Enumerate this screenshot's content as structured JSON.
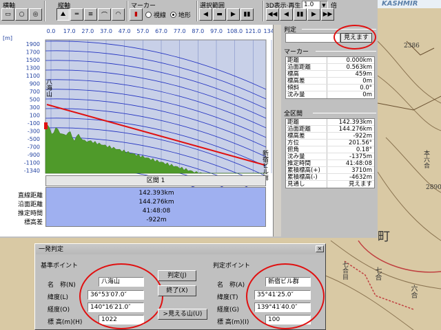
{
  "toolbar": {
    "scale_label": "横軸",
    "vscale_label": "縦軸",
    "marker_label": "マーカー",
    "radio_sightline": "視線",
    "radio_terrain": "地形",
    "selection_label": "選択範囲",
    "display3d_label": "3D表示",
    "playback_label": "再生",
    "speed_value": "1.0",
    "times_label": "倍"
  },
  "chart": {
    "unit_label": "[m]",
    "x_ticks": [
      "0.0",
      "17.0",
      "27.0",
      "37.0",
      "47.0",
      "57.0",
      "67.0",
      "77.0",
      "87.0",
      "97.0",
      "108.0",
      "121.0",
      "134.0"
    ],
    "y_ticks": [
      "1900",
      "1700",
      "1500",
      "1300",
      "1100",
      "900",
      "700",
      "500",
      "300",
      "100",
      "-100",
      "-300",
      "-500",
      "-700",
      "-900",
      "-1100",
      "-1340"
    ],
    "start_point": "八海山",
    "end_point": "新宿ビル群",
    "colors": {
      "terrain": "#4f9a2a",
      "sightline": "#e01010",
      "curves": "#2030c0"
    }
  },
  "section": {
    "header": "区間 1",
    "labels": [
      "直線距離",
      "沿面距離",
      "推定時間",
      "標高差"
    ],
    "values": [
      "142.393km",
      "144.276km",
      "41:48:08",
      "-922m"
    ]
  },
  "judge": {
    "title": "判定",
    "result": "見えます"
  },
  "marker": {
    "title": "マーカー",
    "rows": [
      {
        "k": "距離",
        "v": "0.000km"
      },
      {
        "k": "沿面距離",
        "v": "0.563km"
      },
      {
        "k": "標高",
        "v": "459m"
      },
      {
        "k": "標高差",
        "v": "0m"
      },
      {
        "k": "傾斜",
        "v": "0.0°"
      },
      {
        "k": "沈み量",
        "v": "0m"
      }
    ]
  },
  "full": {
    "title": "全区間",
    "rows": [
      {
        "k": "距離",
        "v": "142.393km"
      },
      {
        "k": "沿面距離",
        "v": "144.276km"
      },
      {
        "k": "標高差",
        "v": "-922m"
      },
      {
        "k": "方位",
        "v": "201.56°"
      },
      {
        "k": "俯角",
        "v": "0.18°"
      },
      {
        "k": "沈み量",
        "v": "-1375m"
      },
      {
        "k": "推定時間",
        "v": "41:48:08"
      },
      {
        "k": "累積標高(+)",
        "v": "3710m"
      },
      {
        "k": "累積標高(-)",
        "v": "-4632m"
      },
      {
        "k": "見通し",
        "v": "見えます"
      }
    ]
  },
  "dialog": {
    "title": "一発判定",
    "close": "×",
    "base_group": "基準ポイント",
    "target_group": "判定ポイント",
    "name_label_base": "名　称(N)",
    "lat_label_base": "緯度(L)",
    "lon_label_base": "経度(O)",
    "elev_label_base": "標 高(m)(H)",
    "name_label_target": "名　称(A)",
    "lat_label_target": "緯度(T)",
    "lon_label_target": "経度(G)",
    "elev_label_target": "標 高(m)(I)",
    "base_name": "八海山",
    "base_lat": "36°53′07.0″",
    "base_lon": "140°16′21.0″",
    "base_elev": "1022",
    "target_name": "新宿ビル群",
    "target_lat": "35°41′25.0″",
    "target_lon": "139°41′40.0″",
    "target_elev": "100",
    "btn_judge": "判定(J)",
    "btn_exit": "終了(X)",
    "btn_visible": ">見える山(U)"
  },
  "map": {
    "brand": "KASHMIR",
    "elev_a": "2386",
    "elev_b": "2890",
    "label_town": "町",
    "label_7go": "七合",
    "label_6go": "六合",
    "label_7go_b": "七合目",
    "label_hon": "本六合"
  }
}
